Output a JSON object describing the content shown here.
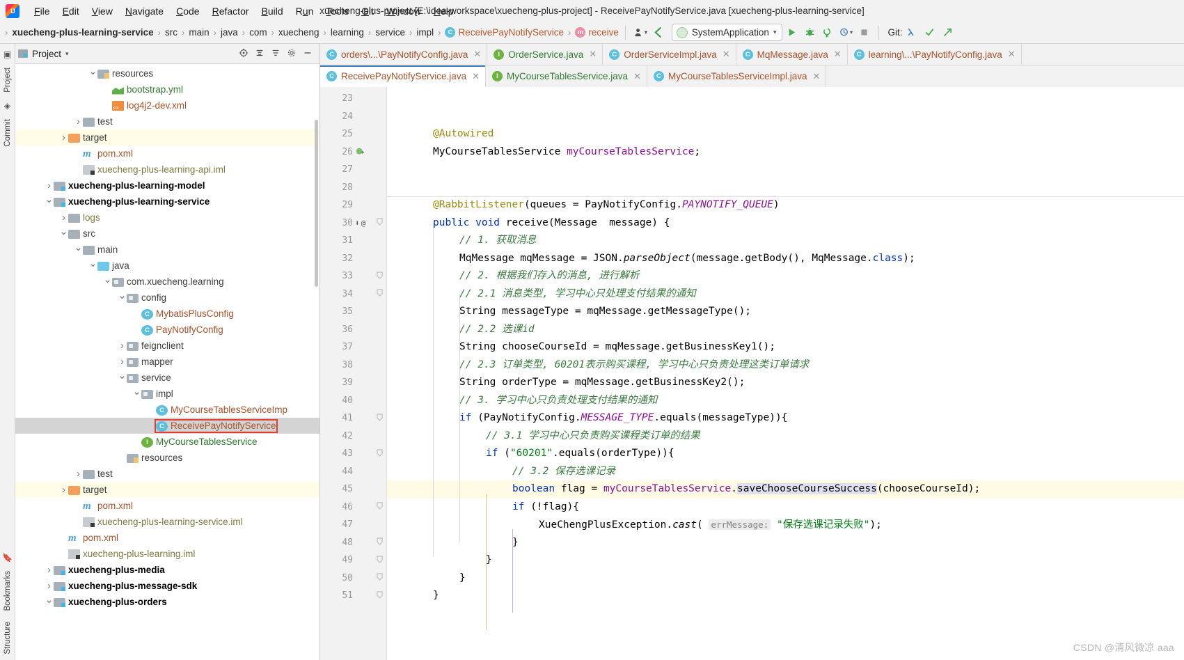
{
  "window": {
    "title": "xuecheng-plus-project [E:\\idea-workspace\\xuecheng-plus-project] - ReceivePayNotifyService.java [xuecheng-plus-learning-service]"
  },
  "menubar": {
    "items": [
      {
        "label": "File",
        "mnemonic": "F"
      },
      {
        "label": "Edit",
        "mnemonic": "E"
      },
      {
        "label": "View",
        "mnemonic": "V"
      },
      {
        "label": "Navigate",
        "mnemonic": "N"
      },
      {
        "label": "Code",
        "mnemonic": "C"
      },
      {
        "label": "Refactor",
        "mnemonic": "R"
      },
      {
        "label": "Build",
        "mnemonic": "B"
      },
      {
        "label": "Run",
        "mnemonic": "u"
      },
      {
        "label": "Tools",
        "mnemonic": "T"
      },
      {
        "label": "Git",
        "mnemonic": "G"
      },
      {
        "label": "Window",
        "mnemonic": "W"
      },
      {
        "label": "Help",
        "mnemonic": "H"
      }
    ]
  },
  "navbar": {
    "breadcrumbs": [
      {
        "label": "xuecheng-plus-learning-service",
        "style": "bold"
      },
      {
        "label": "src",
        "style": "plain"
      },
      {
        "label": "main",
        "style": "plain"
      },
      {
        "label": "java",
        "style": "plain"
      },
      {
        "label": "com",
        "style": "plain"
      },
      {
        "label": "xuecheng",
        "style": "plain"
      },
      {
        "label": "learning",
        "style": "plain"
      },
      {
        "label": "service",
        "style": "plain"
      },
      {
        "label": "impl",
        "style": "plain"
      },
      {
        "label": "ReceivePayNotifyService",
        "style": "class",
        "badge": "C"
      },
      {
        "label": "receive",
        "style": "method",
        "badge": "m"
      }
    ],
    "run_configuration": "SystemApplication",
    "git_label": "Git:",
    "icons": {
      "profile": "user-profile-icon",
      "back": "back-arrow-icon",
      "dropdown": "chevron-down-icon",
      "run": "run-icon",
      "debug": "debug-icon",
      "coverage": "coverage-icon",
      "profiler": "profiler-icon",
      "stop": "stop-icon",
      "git_update": "git-update-icon",
      "git_commit": "git-commit-icon",
      "git_push": "git-push-icon"
    }
  },
  "left_strip": {
    "tabs": [
      "Project",
      "Commit",
      "Bookmarks",
      "Structure"
    ]
  },
  "project_panel": {
    "title": "Project",
    "actions": [
      "target-icon",
      "collapse-icon",
      "sort-icon",
      "gear-icon",
      "minimize-icon"
    ],
    "tree": [
      {
        "indent": 5,
        "arrow": "down",
        "icon": "folder-res",
        "label": "resources",
        "color": "gray"
      },
      {
        "indent": 6,
        "arrow": "none",
        "icon": "yml",
        "label": "bootstrap.yml",
        "color": "green"
      },
      {
        "indent": 6,
        "arrow": "none",
        "icon": "xmlf",
        "label": "log4j2-dev.xml",
        "color": "brown"
      },
      {
        "indent": 4,
        "arrow": "right",
        "icon": "folder",
        "label": "test",
        "color": "gray"
      },
      {
        "indent": 3,
        "arrow": "right",
        "icon": "folder-target",
        "label": "target",
        "color": "gray",
        "row": "sel-target"
      },
      {
        "indent": 4,
        "arrow": "none",
        "icon": "mvn",
        "label": "pom.xml",
        "color": "brown"
      },
      {
        "indent": 4,
        "arrow": "none",
        "icon": "iml",
        "label": "xuecheng-plus-learning-api.iml",
        "color": "olive"
      },
      {
        "indent": 2,
        "arrow": "right",
        "icon": "folder-mod",
        "label": "xuecheng-plus-learning-model",
        "color": "bold"
      },
      {
        "indent": 2,
        "arrow": "down",
        "icon": "folder-mod",
        "label": "xuecheng-plus-learning-service",
        "color": "bold"
      },
      {
        "indent": 3,
        "arrow": "right",
        "icon": "folder",
        "label": "logs",
        "color": "olive"
      },
      {
        "indent": 3,
        "arrow": "down",
        "icon": "folder",
        "label": "src",
        "color": "gray"
      },
      {
        "indent": 4,
        "arrow": "down",
        "icon": "folder",
        "label": "main",
        "color": "gray"
      },
      {
        "indent": 5,
        "arrow": "down",
        "icon": "folder-src",
        "label": "java",
        "color": "gray"
      },
      {
        "indent": 6,
        "arrow": "down",
        "icon": "pkg",
        "label": "com.xuecheng.learning",
        "color": "gray"
      },
      {
        "indent": 7,
        "arrow": "down",
        "icon": "pkg",
        "label": "config",
        "color": "gray"
      },
      {
        "indent": 8,
        "arrow": "none",
        "icon": "cls-c",
        "label": "MybatisPlusConfig",
        "color": "brown"
      },
      {
        "indent": 8,
        "arrow": "none",
        "icon": "cls-c",
        "label": "PayNotifyConfig",
        "color": "brown"
      },
      {
        "indent": 7,
        "arrow": "right",
        "icon": "pkg",
        "label": "feignclient",
        "color": "gray"
      },
      {
        "indent": 7,
        "arrow": "right",
        "icon": "pkg",
        "label": "mapper",
        "color": "gray"
      },
      {
        "indent": 7,
        "arrow": "down",
        "icon": "pkg",
        "label": "service",
        "color": "gray"
      },
      {
        "indent": 8,
        "arrow": "down",
        "icon": "pkg",
        "label": "impl",
        "color": "gray"
      },
      {
        "indent": 9,
        "arrow": "none",
        "icon": "cls-c",
        "label": "MyCourseTablesServiceImp",
        "color": "brown"
      },
      {
        "indent": 9,
        "arrow": "none",
        "icon": "cls-c",
        "label": "ReceivePayNotifyService",
        "color": "brown",
        "row": "sel-gray",
        "boxed": true
      },
      {
        "indent": 8,
        "arrow": "none",
        "icon": "cls-i",
        "label": "MyCourseTablesService",
        "color": "green"
      },
      {
        "indent": 7,
        "arrow": "none",
        "icon": "folder-res",
        "label": "resources",
        "color": "gray"
      },
      {
        "indent": 4,
        "arrow": "right",
        "icon": "folder",
        "label": "test",
        "color": "gray"
      },
      {
        "indent": 3,
        "arrow": "right",
        "icon": "folder-target",
        "label": "target",
        "color": "gray",
        "row": "sel-target"
      },
      {
        "indent": 4,
        "arrow": "none",
        "icon": "mvn",
        "label": "pom.xml",
        "color": "brown"
      },
      {
        "indent": 4,
        "arrow": "none",
        "icon": "iml",
        "label": "xuecheng-plus-learning-service.iml",
        "color": "olive"
      },
      {
        "indent": 3,
        "arrow": "none",
        "icon": "mvn",
        "label": "pom.xml",
        "color": "brown"
      },
      {
        "indent": 3,
        "arrow": "none",
        "icon": "iml",
        "label": "xuecheng-plus-learning.iml",
        "color": "olive"
      },
      {
        "indent": 2,
        "arrow": "right",
        "icon": "folder-mod",
        "label": "xuecheng-plus-media",
        "color": "bold"
      },
      {
        "indent": 2,
        "arrow": "right",
        "icon": "folder-mod",
        "label": "xuecheng-plus-message-sdk",
        "color": "bold"
      },
      {
        "indent": 2,
        "arrow": "down",
        "icon": "folder-mod",
        "label": "xuecheng-plus-orders",
        "color": "bold"
      }
    ]
  },
  "editor": {
    "tabs_row1": [
      {
        "label": "orders\\...\\PayNotifyConfig.java",
        "badge": "C",
        "active": false,
        "closable": true
      },
      {
        "label": "OrderService.java",
        "badge": "I",
        "active": false,
        "closable": true
      },
      {
        "label": "OrderServiceImpl.java",
        "badge": "C",
        "active": false,
        "closable": true
      },
      {
        "label": "MqMessage.java",
        "badge": "C",
        "active": false,
        "closable": true
      },
      {
        "label": "learning\\...\\PayNotifyConfig.java",
        "badge": "C",
        "active": false,
        "closable": true
      }
    ],
    "tabs_row2": [
      {
        "label": "ReceivePayNotifyService.java",
        "badge": "C",
        "active": true,
        "closable": true
      },
      {
        "label": "MyCourseTablesService.java",
        "badge": "I",
        "active": false,
        "closable": true
      },
      {
        "label": "MyCourseTablesServiceImpl.java",
        "badge": "C",
        "active": false,
        "closable": true
      }
    ],
    "line_numbers": [
      23,
      24,
      25,
      26,
      27,
      28,
      29,
      30,
      31,
      32,
      33,
      34,
      35,
      36,
      37,
      38,
      39,
      40,
      41,
      42,
      43,
      44,
      45,
      46,
      47,
      48,
      49,
      50,
      51
    ],
    "code_lines": [
      {
        "n": 23,
        "indent": 0,
        "tokens": []
      },
      {
        "n": 24,
        "indent": 0,
        "tokens": []
      },
      {
        "n": 25,
        "indent": 1,
        "tokens": [
          {
            "t": "@Autowired",
            "c": "anno"
          }
        ]
      },
      {
        "n": 26,
        "indent": 1,
        "gutter_icon": "bean-icon",
        "tokens": [
          {
            "t": "MyCourseTablesService ",
            "c": "typ"
          },
          {
            "t": "myCourseTablesService",
            "c": "fld"
          },
          {
            "t": ";",
            "c": "mth"
          }
        ]
      },
      {
        "n": 27,
        "indent": 0,
        "tokens": []
      },
      {
        "n": 28,
        "indent": 0,
        "tokens": []
      },
      {
        "n": 29,
        "indent": 1,
        "separator_above": true,
        "tokens": [
          {
            "t": "@RabbitListener",
            "c": "anno"
          },
          {
            "t": "(queues = PayNotifyConfig.",
            "c": "mth"
          },
          {
            "t": "PAYNOTIFY_QUEUE",
            "c": "sfld"
          },
          {
            "t": ")",
            "c": "mth"
          }
        ]
      },
      {
        "n": 30,
        "indent": 1,
        "gutter_icon": "override-icon",
        "fold": true,
        "tokens": [
          {
            "t": "public void ",
            "c": "kw"
          },
          {
            "t": "receive",
            "c": "mth"
          },
          {
            "t": "(Message  message) {",
            "c": "mth"
          }
        ]
      },
      {
        "n": 31,
        "indent": 2,
        "tokens": [
          {
            "t": "// 1. 获取消息",
            "c": "cmt"
          }
        ]
      },
      {
        "n": 32,
        "indent": 2,
        "tokens": [
          {
            "t": "MqMessage mqMessage = JSON.",
            "c": "mth"
          },
          {
            "t": "parseObject",
            "c": "smth"
          },
          {
            "t": "(message.getBody(), MqMessage.",
            "c": "mth"
          },
          {
            "t": "class",
            "c": "kw"
          },
          {
            "t": ");",
            "c": "mth"
          }
        ]
      },
      {
        "n": 33,
        "indent": 2,
        "fold": true,
        "tokens": [
          {
            "t": "// 2. 根据我们存入的消息, 进行解析",
            "c": "cmt"
          }
        ]
      },
      {
        "n": 34,
        "indent": 2,
        "fold": true,
        "tokens": [
          {
            "t": "// 2.1 消息类型, 学习中心只处理支付结果的通知",
            "c": "cmt"
          }
        ]
      },
      {
        "n": 35,
        "indent": 2,
        "tokens": [
          {
            "t": "String messageType = mqMessage.getMessageType();",
            "c": "mth"
          }
        ]
      },
      {
        "n": 36,
        "indent": 2,
        "tokens": [
          {
            "t": "// 2.2 选课id",
            "c": "cmt"
          }
        ]
      },
      {
        "n": 37,
        "indent": 2,
        "tokens": [
          {
            "t": "String chooseCourseId = mqMessage.getBusinessKey1();",
            "c": "mth"
          }
        ]
      },
      {
        "n": 38,
        "indent": 2,
        "tokens": [
          {
            "t": "// 2.3 订单类型, 60201表示购买课程, 学习中心只负责处理这类订单请求",
            "c": "cmt"
          }
        ]
      },
      {
        "n": 39,
        "indent": 2,
        "tokens": [
          {
            "t": "String orderType = mqMessage.getBusinessKey2();",
            "c": "mth"
          }
        ]
      },
      {
        "n": 40,
        "indent": 2,
        "tokens": [
          {
            "t": "// 3. 学习中心只负责处理支付结果的通知",
            "c": "cmt"
          }
        ]
      },
      {
        "n": 41,
        "indent": 2,
        "fold": true,
        "tokens": [
          {
            "t": "if ",
            "c": "kw"
          },
          {
            "t": "(PayNotifyConfig.",
            "c": "mth"
          },
          {
            "t": "MESSAGE_TYPE",
            "c": "sfld"
          },
          {
            "t": ".equals(messageType)){",
            "c": "mth"
          }
        ]
      },
      {
        "n": 42,
        "indent": 3,
        "tokens": [
          {
            "t": "// 3.1 学习中心只负责购买课程类订单的结果",
            "c": "cmt"
          }
        ]
      },
      {
        "n": 43,
        "indent": 3,
        "fold": true,
        "tokens": [
          {
            "t": "if ",
            "c": "kw"
          },
          {
            "t": "(",
            "c": "mth"
          },
          {
            "t": "\"60201\"",
            "c": "str"
          },
          {
            "t": ".equals(orderType)){",
            "c": "mth"
          }
        ]
      },
      {
        "n": 44,
        "indent": 4,
        "tokens": [
          {
            "t": "// 3.2 保存选课记录",
            "c": "cmt"
          }
        ]
      },
      {
        "n": 45,
        "indent": 4,
        "highlight": true,
        "tokens": [
          {
            "t": "boolean ",
            "c": "kw"
          },
          {
            "t": "flag = ",
            "c": "mth"
          },
          {
            "t": "myCourseTablesService",
            "c": "fld"
          },
          {
            "t": ".",
            "c": "mth"
          },
          {
            "t": "saveChooseCourseSuccess",
            "c": "usage"
          },
          {
            "t": "(chooseCourseId);",
            "c": "mth"
          }
        ]
      },
      {
        "n": 46,
        "indent": 4,
        "fold": true,
        "tokens": [
          {
            "t": "if ",
            "c": "kw"
          },
          {
            "t": "(!flag){",
            "c": "mth"
          }
        ]
      },
      {
        "n": 47,
        "indent": 5,
        "tokens": [
          {
            "t": "XueChengPlusException.",
            "c": "mth"
          },
          {
            "t": "cast",
            "c": "smth"
          },
          {
            "t": "( ",
            "c": "mth"
          },
          {
            "t": "errMessage:",
            "c": "hint"
          },
          {
            "t": " ",
            "c": "mth"
          },
          {
            "t": "\"保存选课记录失败\"",
            "c": "str"
          },
          {
            "t": ");",
            "c": "mth"
          }
        ]
      },
      {
        "n": 48,
        "indent": 4,
        "fold": true,
        "tokens": [
          {
            "t": "}",
            "c": "mth"
          }
        ]
      },
      {
        "n": 49,
        "indent": 3,
        "fold": true,
        "tokens": [
          {
            "t": "}",
            "c": "mth"
          }
        ]
      },
      {
        "n": 50,
        "indent": 2,
        "fold": true,
        "tokens": [
          {
            "t": "}",
            "c": "mth"
          }
        ]
      },
      {
        "n": 51,
        "indent": 1,
        "fold": true,
        "tokens": [
          {
            "t": "}",
            "c": "mth"
          }
        ]
      }
    ]
  },
  "watermark": "CSDN @清风微凉 aaa",
  "colors": {
    "accent_tab": "#3d7ebc",
    "selection_box": "#e33b2e",
    "row_highlight_yellow": "#fffde8",
    "row_selected_gray": "#d4d4d4",
    "keyword": "#0033b3",
    "comment": "#3a7a40",
    "string": "#067d17",
    "field": "#871094",
    "annotation": "#9e880d"
  }
}
